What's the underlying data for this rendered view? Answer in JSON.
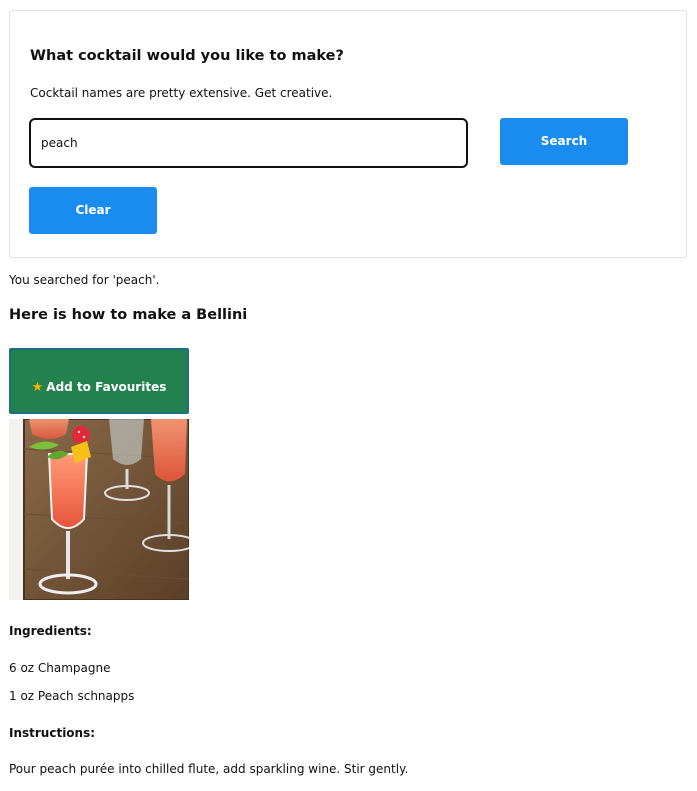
{
  "search_card": {
    "heading": "What cocktail would you like to make?",
    "subtitle": "Cocktail names are pretty extensive. Get creative.",
    "input_value": "peach",
    "search_label": "Search",
    "clear_label": "Clear"
  },
  "result": {
    "searched_text": "You searched for 'peach'.",
    "title": "Here is how to make a Bellini",
    "favourite_label": "Add to Favourites",
    "favourite_icon": "star-icon",
    "ingredients_label": "Ingredients:",
    "ingredients": [
      "6 oz Champagne",
      "1 oz Peach schnapps"
    ],
    "instructions_label": "Instructions:",
    "instructions": "Pour peach purée into chilled flute, add sparkling wine. Stir gently."
  },
  "colors": {
    "primary_button": "#1a8cf0",
    "favourite_button": "#23814e",
    "favourite_border": "#1c6f86",
    "star": "#f5b400"
  }
}
